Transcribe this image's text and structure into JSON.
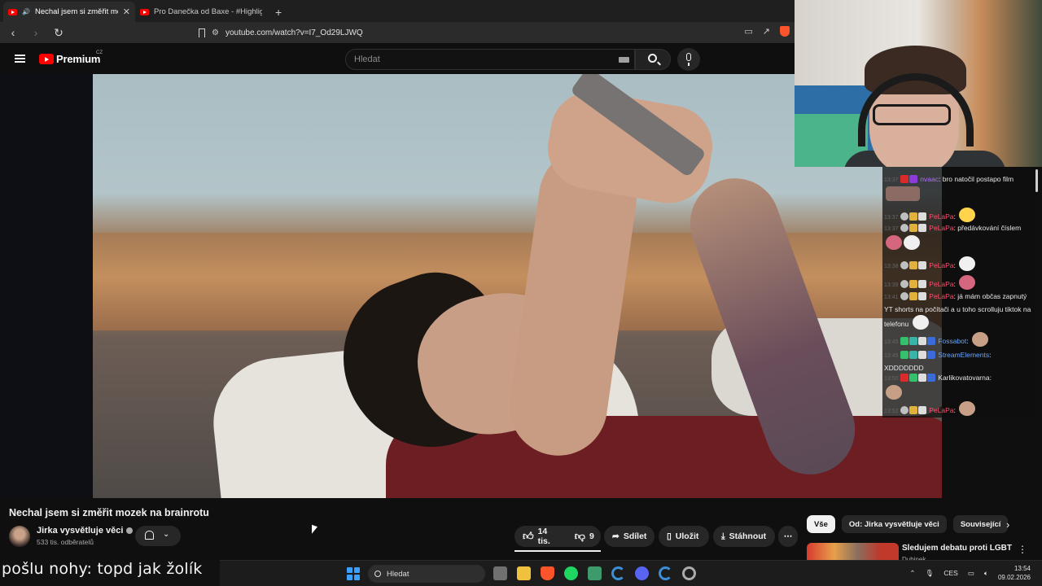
{
  "browser": {
    "tabs": [
      {
        "title": "Nechal jsem si změřit mozek",
        "active": true
      },
      {
        "title": "Pro Danečka od Baxe - #Highlights",
        "active": false
      }
    ],
    "new_tab": "+",
    "url": "youtube.com/watch?v=I7_Od29LJWQ"
  },
  "youtube": {
    "logo_text": "Premium",
    "logo_region": "CZ",
    "search_placeholder": "Hledat",
    "video": {
      "title": "Nechal jsem si změřit mozek na brainrotu",
      "channel": "Jirka vysvětluje věci",
      "subscribers": "533 tis. odběratelů",
      "likes": "14 tis.",
      "dislikes": "9",
      "share_label": "Sdílet",
      "save_label": "Uložit",
      "download_label": "Stáhnout",
      "more_label": "⋯"
    },
    "chips": [
      "Vše",
      "Od: Jirka vysvětluje věci",
      "Související"
    ],
    "recommended": {
      "title": "Sledujem debatu proti LGBT",
      "channel": "Dubinek"
    }
  },
  "chat": {
    "messages": [
      {
        "time": "13:37",
        "user": "nvaac",
        "text": "bro natočil postapo film"
      },
      {
        "time": "13:37",
        "user": "PeLaPa",
        "text": ""
      },
      {
        "time": "13:37",
        "user": "PeLaPa",
        "text": "předávkování číslem"
      },
      {
        "time": "13:38",
        "user": "PeLaPa",
        "text": ""
      },
      {
        "time": "13:39",
        "user": "PeLaPa",
        "text": ""
      },
      {
        "time": "13:41",
        "user": "PeLaPa",
        "text": "já mám občas zapnutý YT shorts na počítači a u toho scrolluju tiktok na telefonu"
      },
      {
        "time": "13:45",
        "user": "Fossabot",
        "text": ""
      },
      {
        "time": "13:45",
        "user": "StreamElements",
        "text": "XDDDDDDD"
      },
      {
        "time": "13:50",
        "user": "Karlikovatovarna",
        "text": ""
      },
      {
        "time": "13:52",
        "user": "PeLaPa",
        "text": ""
      }
    ]
  },
  "overlay_subtitle": "pošlu nohy: topd jak žolík",
  "taskbar": {
    "search_placeholder": "Hledat",
    "language": "CES",
    "time": "13:54",
    "date": "09.02.2026"
  },
  "colors": {
    "youtube_red": "#ff0000",
    "background": "#0f0f0f",
    "chat_user_pink": "#ff4f6e",
    "chat_user_blue": "#6aa6ff"
  }
}
